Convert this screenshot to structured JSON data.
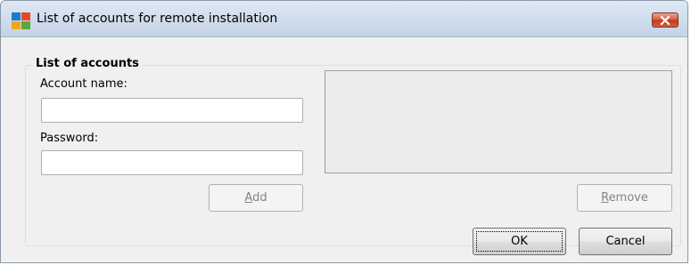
{
  "window": {
    "title": "List of accounts for remote installation",
    "app_icon": "avg-logo-icon",
    "close_icon": "close-icon"
  },
  "group": {
    "legend": "List of accounts",
    "account_name_label": "Account name:",
    "account_name_value": "",
    "password_label": "Password:",
    "password_value": ""
  },
  "buttons": {
    "add": {
      "mnemonic": "A",
      "rest": "dd",
      "enabled": false
    },
    "remove": {
      "mnemonic": "R",
      "rest": "emove",
      "enabled": false
    },
    "ok": {
      "label": "OK",
      "focused": true
    },
    "cancel": {
      "label": "Cancel"
    }
  },
  "accounts": [],
  "colors": {
    "titlebar": "#cfdcec",
    "dialog_bg": "#f0f0f0",
    "close_red": "#c5381c"
  }
}
